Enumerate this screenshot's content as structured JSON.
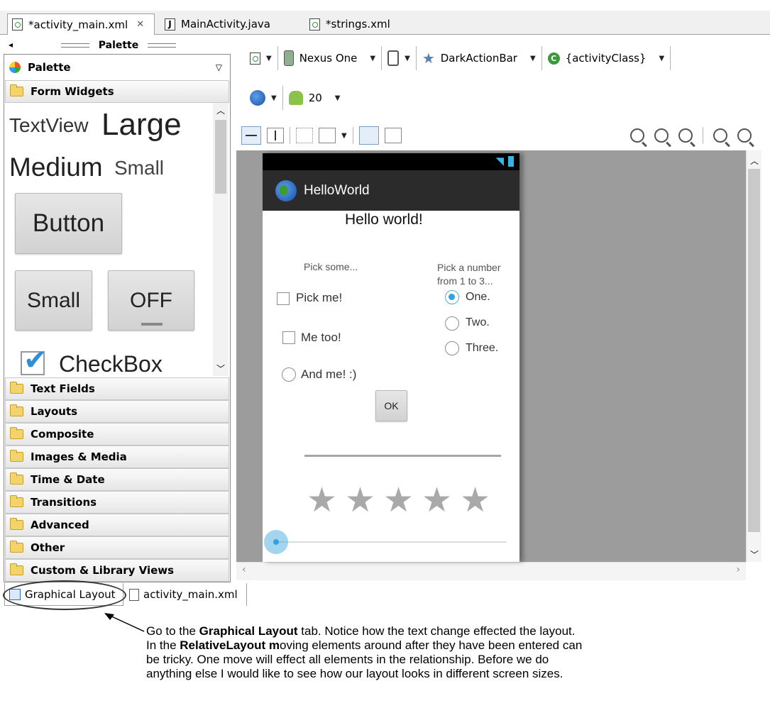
{
  "editor_tabs": [
    {
      "label": "*activity_main.xml",
      "active": true
    },
    {
      "label": "MainActivity.java",
      "active": false
    },
    {
      "label": "*strings.xml",
      "active": false
    }
  ],
  "palette": {
    "header": "Palette",
    "title": "Palette",
    "categories": [
      "Form Widgets",
      "Text Fields",
      "Layouts",
      "Composite",
      "Images & Media",
      "Time & Date",
      "Transitions",
      "Advanced",
      "Other",
      "Custom & Library Views"
    ],
    "widgets": {
      "textview": "TextView",
      "large": "Large",
      "medium": "Medium",
      "small": "Small",
      "button": "Button",
      "small_button": "Small",
      "toggle": "OFF",
      "checkbox": "CheckBox"
    }
  },
  "toolbar": {
    "device": "Nexus One",
    "theme": "DarkActionBar",
    "activity": "{activityClass}",
    "api_level": "20"
  },
  "preview": {
    "app_title": "HelloWorld",
    "hello": "Hello world!",
    "pick_some": "Pick some...",
    "pick_number": "Pick a number from 1 to 3...",
    "checkboxes": [
      "Pick me!",
      "Me too!",
      "And me! :)"
    ],
    "radios": [
      "One.",
      "Two.",
      "Three."
    ],
    "radio_selected": 0,
    "ok_button": "OK",
    "rating_stars": 5,
    "seekbar_value": 0
  },
  "bottom_tabs": [
    {
      "label": "Graphical Layout",
      "active": true
    },
    {
      "label": "activity_main.xml",
      "active": false
    }
  ],
  "callout": {
    "p1": "Go to the ",
    "b1": "Graphical Layout",
    "p2": " tab. Notice how the text change effected the layout. In the ",
    "b2": "RelativeLayout m",
    "p3": "oving elements around after they have been entered can be tricky. One move will effect all elements in the relationship. Before we do anything else I would like to see how our layout looks in different screen sizes."
  },
  "colors": {
    "accent": "#33a1dc",
    "action_bar": "#2b2b2b",
    "canvas": "#9c9c9c"
  }
}
